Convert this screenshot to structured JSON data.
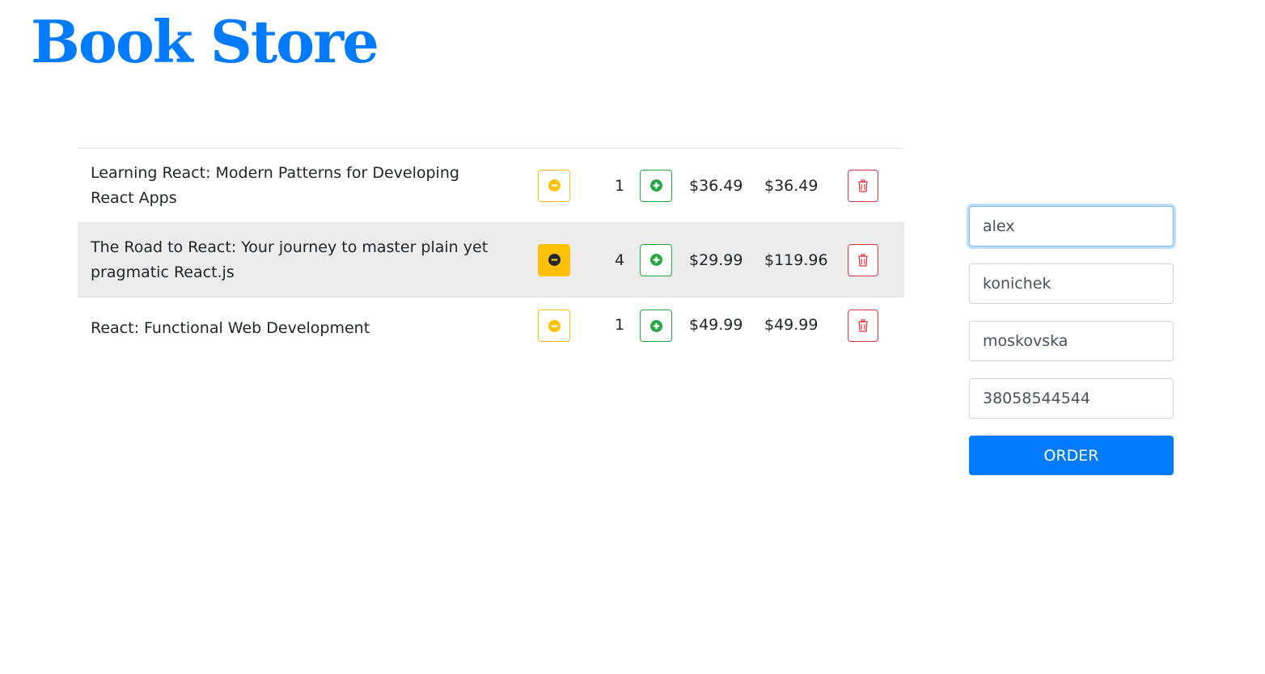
{
  "header": {
    "title": "Book Store"
  },
  "colors": {
    "primary": "#007bff",
    "warning": "#ffc107",
    "success": "#28a745",
    "danger": "#dc3545",
    "row_hover": "#ececec"
  },
  "cart": {
    "items": [
      {
        "title": "Learning React: Modern Patterns for Developing React Apps",
        "quantity": "1",
        "price": "$36.49",
        "total": "$36.49"
      },
      {
        "title": "The Road to React: Your journey to master plain yet pragmatic React.js",
        "quantity": "4",
        "price": "$29.99",
        "total": "$119.96"
      },
      {
        "title": "React: Functional Web Development",
        "quantity": "1",
        "price": "$49.99",
        "total": "$49.99"
      }
    ],
    "icons": {
      "decrease": "minus-circle-icon",
      "increase": "plus-circle-icon",
      "remove": "trash-icon"
    }
  },
  "order_form": {
    "first_name": "alex",
    "last_name": "konichek",
    "address": "moskovska",
    "phone": "38058544544",
    "submit_label": "ORDER"
  }
}
